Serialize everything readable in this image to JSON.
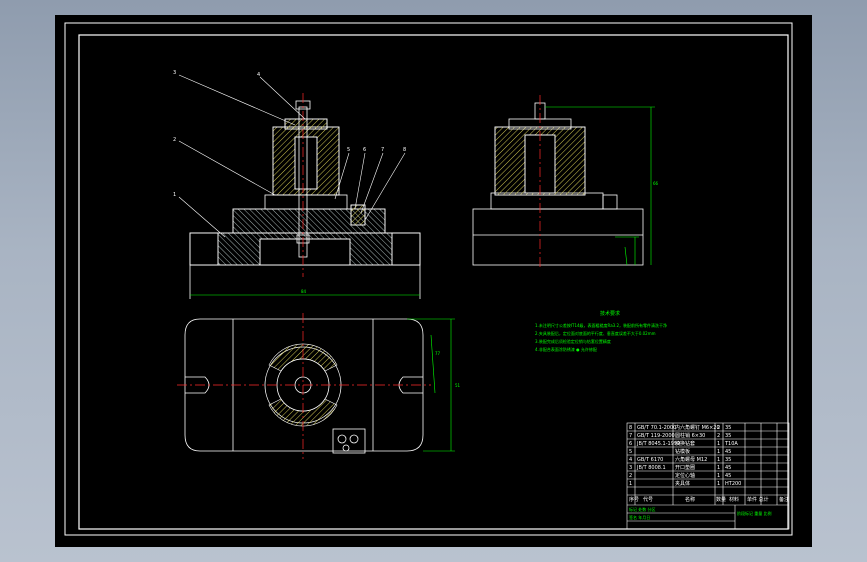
{
  "colors": {
    "background": "#000000",
    "frame": "#ffffff",
    "part": "#ffffff",
    "hatch": "#e6dc5a",
    "dimension": "#00ff00",
    "centerline": "#ff2a2a",
    "note": "#00ff00",
    "chrome": "#a9b4c3"
  },
  "balloons": [
    "3",
    "4",
    "2",
    "1",
    "5",
    "6",
    "7",
    "8"
  ],
  "dimensions": {
    "front_width": "84",
    "side_height": "66",
    "plan_width": "77",
    "plan_height": "51"
  },
  "technical_requirements": {
    "title": "技术要求",
    "lines": [
      "1.未注明尺寸公差按IT14级，表面粗糙度Ra3.2，装配前所有零件清洗干净",
      "2.夹具装配后，定位面对底面的平行度、垂直度误差不大于0.02mm",
      "3.装配完成后须检验定位销与钻套位置精度",
      "4.非配合表面涂防锈漆 ● 允许修配"
    ]
  },
  "bom_rows": [
    {
      "no": "8",
      "code": "GB/T 70.1-2000",
      "name": "内六角螺钉 M6×20",
      "qty": "2",
      "material": "35"
    },
    {
      "no": "7",
      "code": "GB/T 119-2000",
      "name": "圆柱销 6×30",
      "qty": "2",
      "material": "35"
    },
    {
      "no": "6",
      "code": "JB/T 8045.1-1999",
      "name": "快换钻套",
      "qty": "1",
      "material": "T10A"
    },
    {
      "no": "5",
      "code": "",
      "name": "钻模板",
      "qty": "1",
      "material": "45"
    },
    {
      "no": "4",
      "code": "GB/T 6170",
      "name": "六角螺母 M12",
      "qty": "1",
      "material": "35"
    },
    {
      "no": "3",
      "code": "JB/T 8008.1",
      "name": "开口垫圈",
      "qty": "1",
      "material": "45"
    },
    {
      "no": "2",
      "code": "",
      "name": "定位心轴",
      "qty": "1",
      "material": "45"
    },
    {
      "no": "1",
      "code": "",
      "name": "夹具体",
      "qty": "1",
      "material": "HT200"
    }
  ],
  "title_block": {
    "header_no": "序号",
    "header_code": "代号",
    "header_name": "名称",
    "header_qty": "数量",
    "header_material": "材料",
    "header_mass": "单件 总计",
    "header_note": "备注",
    "footer_left": "标记 处数 分区",
    "footer_mid": "签名 年月日",
    "footer_right": "阶段标记 重量 比例"
  }
}
